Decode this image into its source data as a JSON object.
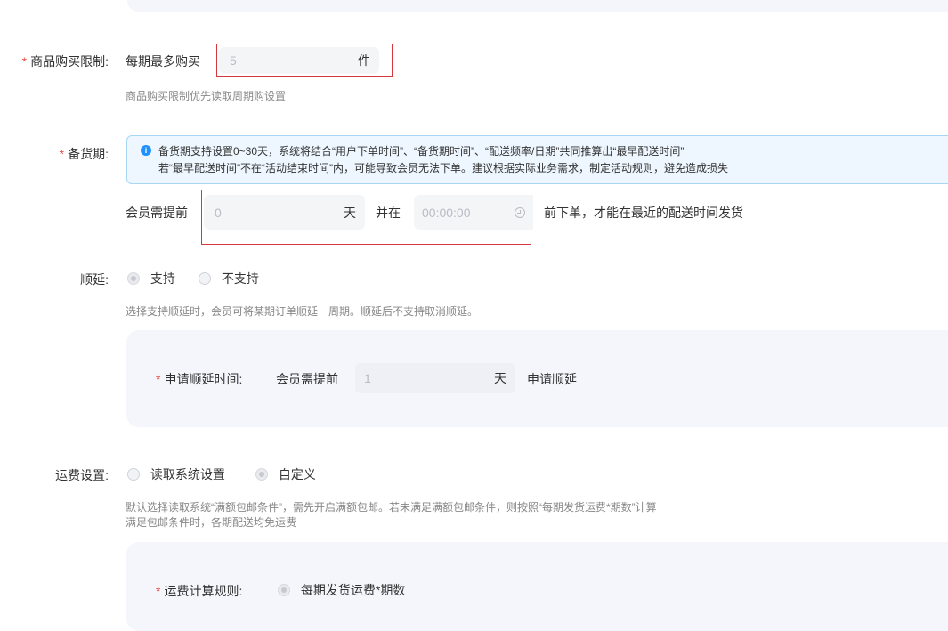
{
  "purchase_limit": {
    "required_mark": "*",
    "label": "商品购买限制:",
    "prefix": "每期最多购买",
    "value": "5",
    "unit": "件",
    "hint": "商品购买限制优先读取周期购设置"
  },
  "stock_period": {
    "required_mark": "*",
    "label": "备货期:",
    "info_icon": "info-icon",
    "info_line1": "备货期支持设置0~30天，系统将结合“用户下单时间”、“备货期时间”、“配送频率/日期”共同推算出“最早配送时间”",
    "info_line2": "若“最早配送时间”不在“活动结束时间”内，可能导致会员无法下单。建议根据实际业务需求，制定活动规则，避免造成损失",
    "prefix": "会员需提前",
    "days_value": "0",
    "days_unit": "天",
    "middle": "并在",
    "time_value": "00:00:00",
    "time_icon": "clock-icon",
    "suffix": "前下单，才能在最近的配送时间发货"
  },
  "postpone": {
    "label": "顺延:",
    "options": [
      "支持",
      "不支持"
    ],
    "selected": "支持",
    "hint": "选择支持顺延时，会员可将某期订单顺延一周期。顺延后不支持取消顺延。",
    "apply": {
      "required_mark": "*",
      "label": "申请顺延时间:",
      "prefix": "会员需提前",
      "value": "1",
      "unit": "天",
      "suffix": "申请顺延"
    }
  },
  "shipping": {
    "label": "运费设置:",
    "options": [
      "读取系统设置",
      "自定义"
    ],
    "selected": "自定义",
    "hint_line1": "默认选择读取系统“满额包邮条件”，需先开启满额包邮。若未满足满额包邮条件，则按照“每期发货运费*期数”计算",
    "hint_line2": "满足包邮条件时，各期配送均免运费",
    "rule": {
      "required_mark": "*",
      "label": "运费计算规则:",
      "option": "每期发货运费*期数"
    }
  }
}
